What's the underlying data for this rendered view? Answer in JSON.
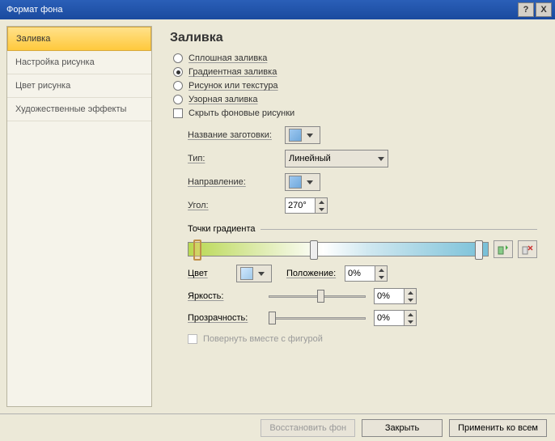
{
  "title": "Формат фона",
  "sidebar": {
    "items": [
      {
        "label": "Заливка"
      },
      {
        "label": "Настройка рисунка"
      },
      {
        "label": "Цвет рисунка"
      },
      {
        "label": "Художественные эффекты"
      }
    ],
    "active_index": 0
  },
  "main": {
    "heading": "Заливка",
    "fill_options": {
      "solid": "Сплошная заливка",
      "gradient": "Градиентная заливка",
      "picture": "Рисунок или текстура",
      "pattern": "Узорная заливка",
      "selected": "gradient"
    },
    "hide_bg": {
      "label": "Скрыть фоновые рисунки",
      "checked": false
    },
    "preset": {
      "label": "Название заготовки:"
    },
    "type": {
      "label": "Тип:",
      "value": "Линейный"
    },
    "direction": {
      "label": "Направление:"
    },
    "angle": {
      "label": "Угол:",
      "value": "270°"
    },
    "stops_header": "Точки градиента",
    "color": {
      "label": "Цвет"
    },
    "position": {
      "label": "Положение:",
      "value": "0%"
    },
    "brightness": {
      "label": "Яркость:",
      "value": "0%",
      "slider": 50
    },
    "transparency": {
      "label": "Прозрачность:",
      "value": "0%",
      "slider": 0
    },
    "rotate": {
      "label": "Повернуть вместе с фигурой",
      "checked": false
    }
  },
  "footer": {
    "restore": "Восстановить фон",
    "close": "Закрыть",
    "apply_all": "Применить ко всем"
  }
}
